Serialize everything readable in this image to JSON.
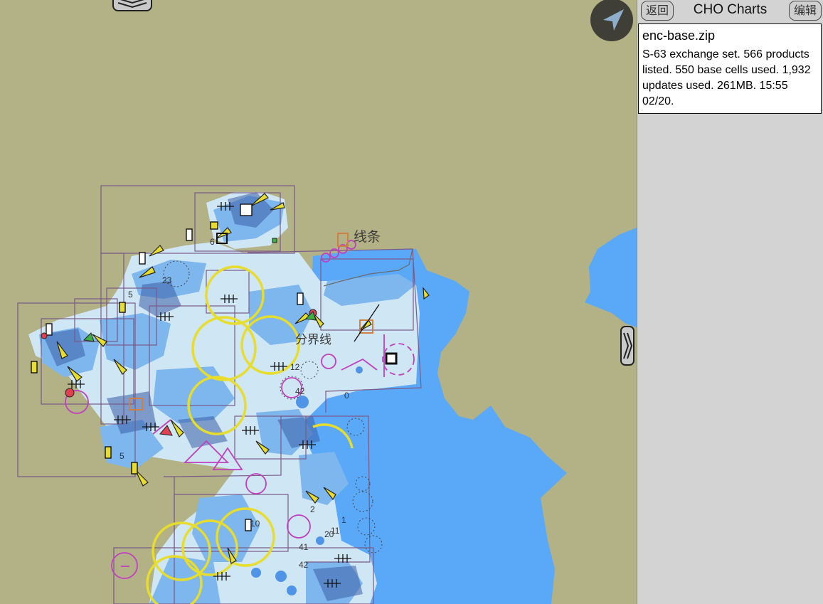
{
  "panel": {
    "title": "CHO Charts",
    "back_label": "返回",
    "edit_label": "编辑",
    "file": {
      "name": "enc-base.zip",
      "description": "S-63 exchange set.  566 products listed.  550 base cells used.  1,932 updates used.  261MB.  15:55 02/20."
    }
  },
  "map": {
    "line_label": "线条",
    "annotation_label": "分界线",
    "soundings": [
      "23",
      "41",
      "6",
      "5",
      "42",
      "1",
      "10",
      "2",
      "11",
      "20",
      "42",
      "5",
      "0",
      "12"
    ],
    "colors": {
      "land": "#b3b186",
      "deep_water": "#5aa8f8",
      "shallow_water": "#cfe6f4",
      "medium_water": "#7eb6ee",
      "chart_boundary": "#7a5a88",
      "magenta": "#c040c0",
      "light_ring": "#e8dc2c"
    }
  },
  "icons": {
    "collapse": "chevron-double-down-icon",
    "navigation": "navigation-arrow-icon",
    "panel_toggle": "chevron-double-right-icon"
  }
}
